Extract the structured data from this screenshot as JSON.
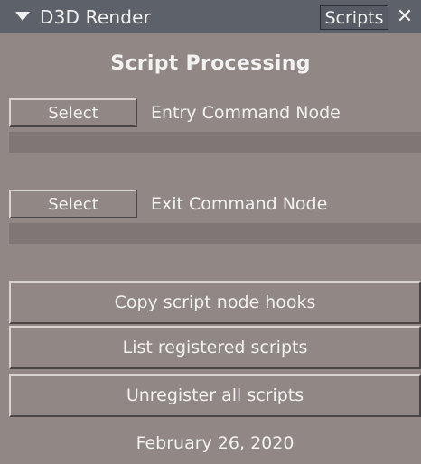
{
  "titlebar": {
    "title": "D3D Render",
    "tab": "Scripts",
    "close_glyph": "✕",
    "collapse_icon": "triangle-down"
  },
  "heading": "Script Processing",
  "entry": {
    "button": "Select",
    "label": "Entry Command Node",
    "value": ""
  },
  "exit": {
    "button": "Select",
    "label": "Exit Command Node",
    "value": ""
  },
  "actions": {
    "copy": "Copy script node hooks",
    "list": "List registered scripts",
    "unregister": "Unregister all scripts"
  },
  "date": "February 26, 2020",
  "colors": {
    "panel": "#918885",
    "titlebar": "#5d6169",
    "field": "#7f7775",
    "text": "#f1f1f1"
  }
}
